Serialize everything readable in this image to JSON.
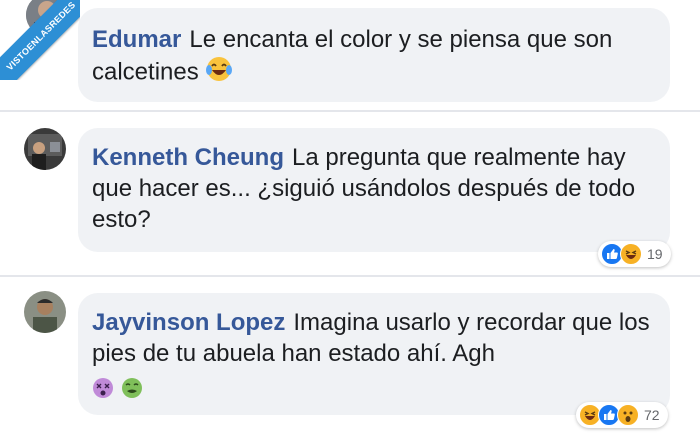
{
  "watermark": {
    "text": "VISTOENLASREDES"
  },
  "comments": [
    {
      "author": "Edumar",
      "text": "Le encanta el color y se piensa que son calcetines",
      "emoji": "laughing-tears-emoji"
    },
    {
      "author": "Kenneth Cheung",
      "text": "La pregunta que realmente hay que hacer es... ¿siguió usándolos después de todo esto?",
      "reactions": {
        "icons": [
          "like-icon",
          "haha-icon"
        ],
        "count": "19"
      }
    },
    {
      "author": "Jayvinson Lopez",
      "text": "Imagina usarlo y recordar que los pies de tu abuela han estado ahí. Agh",
      "emojis": [
        "dizzy-face-emoji",
        "nauseated-face-emoji"
      ],
      "reactions": {
        "icons": [
          "haha-icon",
          "like-icon",
          "wow-icon"
        ],
        "count": "72"
      }
    }
  ],
  "colors": {
    "author_name": "#365899",
    "bubble_bg": "#f0f2f5",
    "banner": "#2d8fd5"
  }
}
